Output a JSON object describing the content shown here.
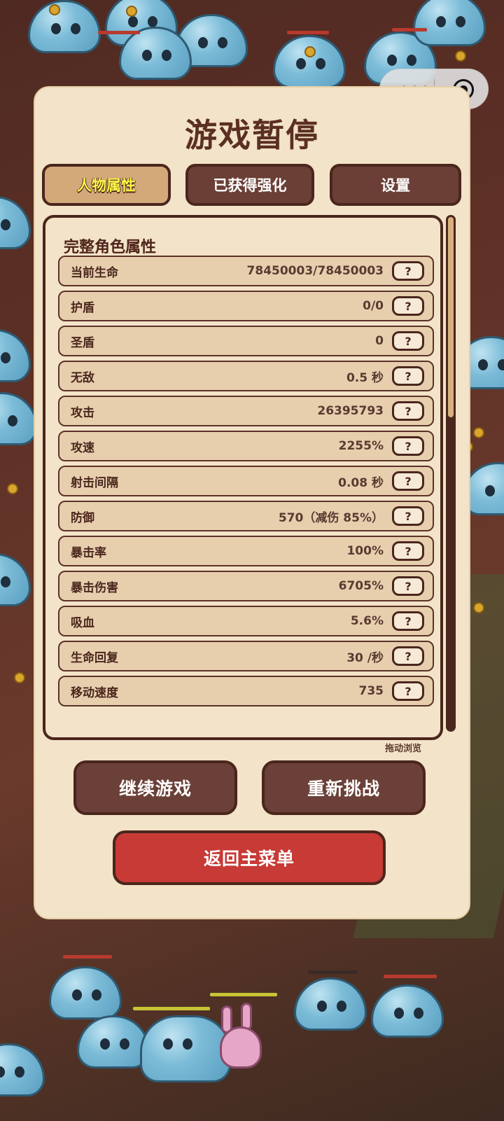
{
  "pause": {
    "title": "游戏暂停",
    "tabs": [
      {
        "label": "人物属性",
        "active": true
      },
      {
        "label": "已获得强化",
        "active": false
      },
      {
        "label": "设置",
        "active": false
      }
    ],
    "section_title": "完整角色属性",
    "stats": [
      {
        "label": "当前生命",
        "value": "78450003/78450003"
      },
      {
        "label": "护盾",
        "value": "0/0"
      },
      {
        "label": "圣盾",
        "value": "0"
      },
      {
        "label": "无敌",
        "value": "0.5 秒"
      },
      {
        "label": "攻击",
        "value": "26395793"
      },
      {
        "label": "攻速",
        "value": "2255%"
      },
      {
        "label": "射击间隔",
        "value": "0.08 秒"
      },
      {
        "label": "防御",
        "value": "570（减伤 85%）"
      },
      {
        "label": "暴击率",
        "value": "100%"
      },
      {
        "label": "暴击伤害",
        "value": "6705%"
      },
      {
        "label": "吸血",
        "value": "5.6%"
      },
      {
        "label": "生命回复",
        "value": "30 /秒"
      },
      {
        "label": "移动速度",
        "value": "735"
      }
    ],
    "help_label": "?",
    "drag_hint": "拖动浏览",
    "buttons": {
      "continue": "继续游戏",
      "retry": "重新挑战",
      "main_menu": "返回主菜单"
    }
  },
  "capsule": {
    "more_glyph": "•••"
  },
  "colors": {
    "panel_bg": "#f3e3c8",
    "border_dark": "#4a261d",
    "tab_bg": "#6b3f36",
    "tab_active_bg": "#d4a97a",
    "tab_active_text": "#fff84a",
    "red_button": "#c73a36",
    "row_bg": "#e7cfae"
  }
}
